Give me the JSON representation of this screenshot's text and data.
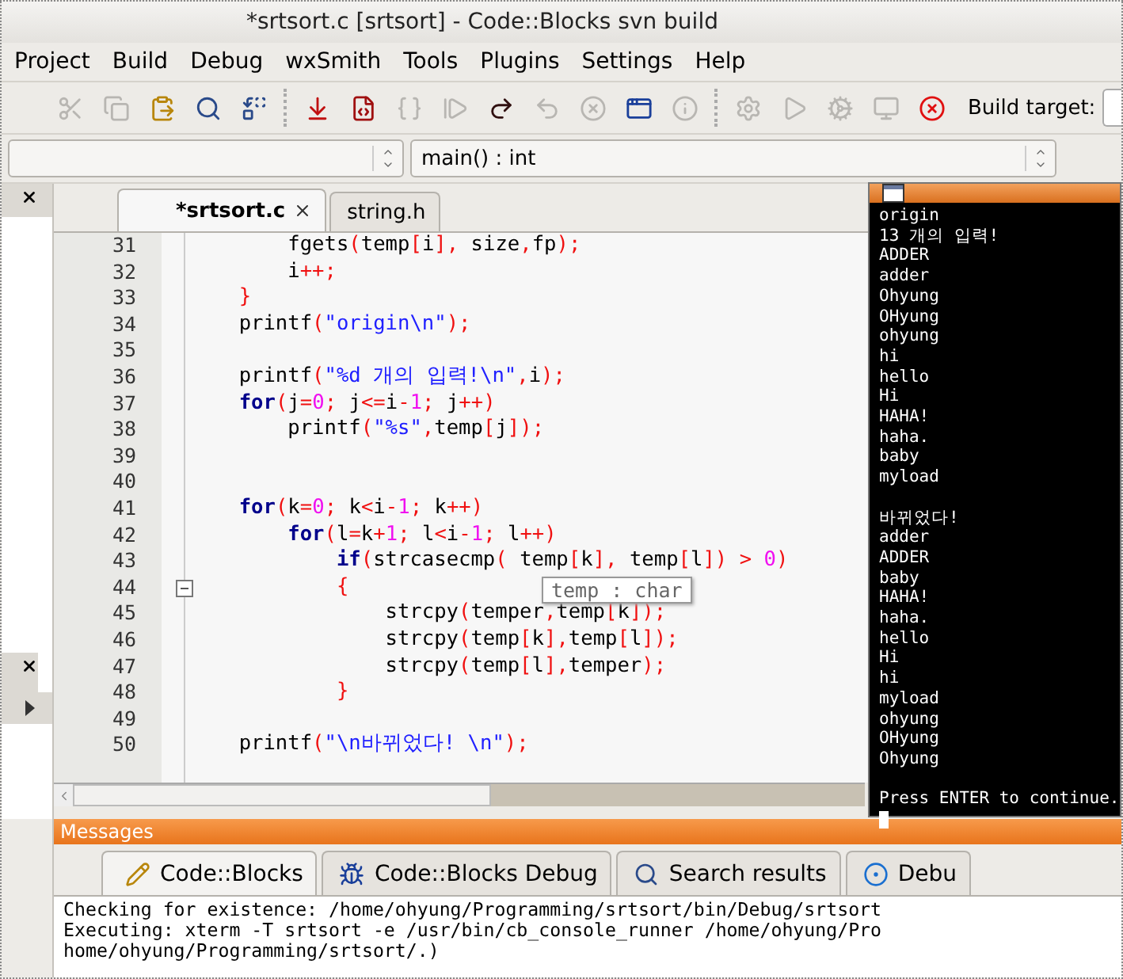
{
  "window": {
    "title": "*srtsort.c [srtsort] - Code::Blocks svn build"
  },
  "menu": [
    "Project",
    "Build",
    "Debug",
    "wxSmith",
    "Tools",
    "Plugins",
    "Settings",
    "Help"
  ],
  "toolbar": [
    [
      {
        "disabled": true
      },
      {
        "disabled": true
      },
      {
        "disabled": false
      },
      {
        "disabled": false
      },
      {
        "disabled": false
      }
    ],
    [
      {
        "disabled": false
      },
      {
        "disabled": false
      },
      {
        "disabled": true
      },
      {
        "disabled": true
      },
      {
        "disabled": false
      },
      {
        "disabled": true
      },
      {
        "disabled": true
      },
      {
        "disabled": false
      },
      {
        "disabled": true
      }
    ],
    [
      {
        "disabled": true
      },
      {
        "disabled": true
      },
      {
        "disabled": true
      },
      {
        "disabled": true
      },
      {
        "disabled": false
      }
    ]
  ],
  "build_target": {
    "label": "Build target:"
  },
  "symbol_bar": {
    "function": "main() : int"
  },
  "editor": {
    "tabs": [
      {
        "label": "*srtsort.c",
        "selected": true
      },
      {
        "label": "string.h",
        "selected": false
      }
    ],
    "lines": [
      {
        "number": "31",
        "tokens": [
          {
            "kind": "plain",
            "text": "        fgets"
          },
          {
            "kind": "punct",
            "text": "("
          },
          {
            "kind": "plain",
            "text": "temp"
          },
          {
            "kind": "punct",
            "text": "["
          },
          {
            "kind": "plain",
            "text": "i"
          },
          {
            "kind": "punct",
            "text": "],"
          },
          {
            "kind": "plain",
            "text": " size"
          },
          {
            "kind": "punct",
            "text": ","
          },
          {
            "kind": "plain",
            "text": "fp"
          },
          {
            "kind": "punct",
            "text": ");"
          }
        ]
      },
      {
        "number": "32",
        "tokens": [
          {
            "kind": "plain",
            "text": "        i"
          },
          {
            "kind": "punct",
            "text": "++;"
          }
        ]
      },
      {
        "number": "33",
        "tokens": [
          {
            "kind": "punct",
            "text": "    }"
          }
        ]
      },
      {
        "number": "34",
        "tokens": [
          {
            "kind": "plain",
            "text": "    printf"
          },
          {
            "kind": "punct",
            "text": "("
          },
          {
            "kind": "string",
            "text": "\"origin\\n\""
          },
          {
            "kind": "punct",
            "text": ");"
          }
        ]
      },
      {
        "number": "35"
      },
      {
        "number": "36",
        "tokens": [
          {
            "kind": "plain",
            "text": "    printf"
          },
          {
            "kind": "punct",
            "text": "("
          },
          {
            "kind": "string",
            "text": "\"%d 개의 입력!\\n\""
          },
          {
            "kind": "punct",
            "text": ","
          },
          {
            "kind": "plain",
            "text": "i"
          },
          {
            "kind": "punct",
            "text": ");"
          }
        ]
      },
      {
        "number": "37",
        "tokens": [
          {
            "kind": "keyword",
            "text": "    for"
          },
          {
            "kind": "punct",
            "text": "("
          },
          {
            "kind": "plain",
            "text": "j"
          },
          {
            "kind": "punct",
            "text": "="
          },
          {
            "kind": "number",
            "text": "0"
          },
          {
            "kind": "punct",
            "text": ";"
          },
          {
            "kind": "plain",
            "text": " j"
          },
          {
            "kind": "punct",
            "text": "<="
          },
          {
            "kind": "plain",
            "text": "i"
          },
          {
            "kind": "punct",
            "text": "-"
          },
          {
            "kind": "number",
            "text": "1"
          },
          {
            "kind": "punct",
            "text": ";"
          },
          {
            "kind": "plain",
            "text": " j"
          },
          {
            "kind": "punct",
            "text": "++)"
          }
        ]
      },
      {
        "number": "38",
        "tokens": [
          {
            "kind": "plain",
            "text": "        printf"
          },
          {
            "kind": "punct",
            "text": "("
          },
          {
            "kind": "string",
            "text": "\"%s\""
          },
          {
            "kind": "punct",
            "text": ","
          },
          {
            "kind": "plain",
            "text": "temp"
          },
          {
            "kind": "punct",
            "text": "["
          },
          {
            "kind": "plain",
            "text": "j"
          },
          {
            "kind": "punct",
            "text": "]);"
          }
        ]
      },
      {
        "number": "39"
      },
      {
        "number": "40"
      },
      {
        "number": "41",
        "tokens": [
          {
            "kind": "keyword",
            "text": "    for"
          },
          {
            "kind": "punct",
            "text": "("
          },
          {
            "kind": "plain",
            "text": "k"
          },
          {
            "kind": "punct",
            "text": "="
          },
          {
            "kind": "number",
            "text": "0"
          },
          {
            "kind": "punct",
            "text": ";"
          },
          {
            "kind": "plain",
            "text": " k"
          },
          {
            "kind": "punct",
            "text": "<"
          },
          {
            "kind": "plain",
            "text": "i"
          },
          {
            "kind": "punct",
            "text": "-"
          },
          {
            "kind": "number",
            "text": "1"
          },
          {
            "kind": "punct",
            "text": ";"
          },
          {
            "kind": "plain",
            "text": " k"
          },
          {
            "kind": "punct",
            "text": "++)"
          }
        ]
      },
      {
        "number": "42",
        "tokens": [
          {
            "kind": "keyword",
            "text": "        for"
          },
          {
            "kind": "punct",
            "text": "("
          },
          {
            "kind": "plain",
            "text": "l"
          },
          {
            "kind": "punct",
            "text": "="
          },
          {
            "kind": "plain",
            "text": "k"
          },
          {
            "kind": "punct",
            "text": "+"
          },
          {
            "kind": "number",
            "text": "1"
          },
          {
            "kind": "punct",
            "text": ";"
          },
          {
            "kind": "plain",
            "text": " l"
          },
          {
            "kind": "punct",
            "text": "<"
          },
          {
            "kind": "plain",
            "text": "i"
          },
          {
            "kind": "punct",
            "text": "-"
          },
          {
            "kind": "number",
            "text": "1"
          },
          {
            "kind": "punct",
            "text": ";"
          },
          {
            "kind": "plain",
            "text": " l"
          },
          {
            "kind": "punct",
            "text": "++)"
          }
        ]
      },
      {
        "number": "43",
        "tokens": [
          {
            "kind": "keyword",
            "text": "            if"
          },
          {
            "kind": "punct",
            "text": "("
          },
          {
            "kind": "plain",
            "text": "strcasecmp"
          },
          {
            "kind": "punct",
            "text": "("
          },
          {
            "kind": "plain",
            "text": " temp"
          },
          {
            "kind": "punct",
            "text": "["
          },
          {
            "kind": "plain",
            "text": "k"
          },
          {
            "kind": "punct",
            "text": "],"
          },
          {
            "kind": "plain",
            "text": " temp"
          },
          {
            "kind": "punct",
            "text": "["
          },
          {
            "kind": "plain",
            "text": "l"
          },
          {
            "kind": "punct",
            "text": "]) > "
          },
          {
            "kind": "number",
            "text": "0"
          },
          {
            "kind": "punct",
            "text": ")"
          }
        ]
      },
      {
        "number": "44",
        "fold": true,
        "tokens": [
          {
            "kind": "punct",
            "text": "            {"
          }
        ]
      },
      {
        "number": "45",
        "tokens": [
          {
            "kind": "plain",
            "text": "                strcpy"
          },
          {
            "kind": "punct",
            "text": "("
          },
          {
            "kind": "plain",
            "text": "temper"
          },
          {
            "kind": "punct",
            "text": ","
          },
          {
            "kind": "plain",
            "text": "temp"
          },
          {
            "kind": "punct",
            "text": "["
          },
          {
            "kind": "plain",
            "text": "k"
          },
          {
            "kind": "punct",
            "text": "]);"
          }
        ]
      },
      {
        "number": "46",
        "tokens": [
          {
            "kind": "plain",
            "text": "                strcpy"
          },
          {
            "kind": "punct",
            "text": "("
          },
          {
            "kind": "plain",
            "text": "temp"
          },
          {
            "kind": "punct",
            "text": "["
          },
          {
            "kind": "plain",
            "text": "k"
          },
          {
            "kind": "punct",
            "text": "],"
          },
          {
            "kind": "plain",
            "text": "temp"
          },
          {
            "kind": "punct",
            "text": "["
          },
          {
            "kind": "plain",
            "text": "l"
          },
          {
            "kind": "punct",
            "text": "]);"
          }
        ]
      },
      {
        "number": "47",
        "tokens": [
          {
            "kind": "plain",
            "text": "                strcpy"
          },
          {
            "kind": "punct",
            "text": "("
          },
          {
            "kind": "plain",
            "text": "temp"
          },
          {
            "kind": "punct",
            "text": "["
          },
          {
            "kind": "plain",
            "text": "l"
          },
          {
            "kind": "punct",
            "text": "],"
          },
          {
            "kind": "plain",
            "text": "temper"
          },
          {
            "kind": "punct",
            "text": ");"
          }
        ]
      },
      {
        "number": "48",
        "tokens": [
          {
            "kind": "punct",
            "text": "            }"
          }
        ]
      },
      {
        "number": "49"
      },
      {
        "number": "50",
        "tokens": [
          {
            "kind": "plain",
            "text": "    printf"
          },
          {
            "kind": "punct",
            "text": "("
          },
          {
            "kind": "string",
            "text": "\"\\n바뀌었다! \\n\""
          },
          {
            "kind": "punct",
            "text": ");"
          }
        ]
      }
    ],
    "tooltip": "temp : char"
  },
  "messages": {
    "title": "Messages",
    "tabs": [
      {
        "label": "Code::Blocks",
        "selected": true
      },
      {
        "label": "Code::Blocks Debug",
        "selected": false
      },
      {
        "label": "Search results",
        "selected": false
      },
      {
        "label": "Debu",
        "selected": false
      }
    ],
    "log": [
      "Checking for existence: /home/ohyung/Programming/srtsort/bin/Debug/srtsort",
      "Executing: xterm -T srtsort -e /usr/bin/cb_console_runner /home/ohyung/Pro",
      "home/ohyung/Programming/srtsort/.)"
    ]
  },
  "terminal": {
    "blocks": [
      [
        "origin",
        "13 개의 입력!",
        "ADDER",
        "adder",
        "Ohyung",
        "OHyung",
        "ohyung",
        "hi",
        "hello",
        "Hi",
        "HAHA!",
        "haha.",
        "baby",
        "myload"
      ],
      [
        "바뀌었다!",
        "adder",
        "ADDER",
        "baby",
        "HAHA!",
        "haha.",
        "hello",
        "Hi",
        "hi",
        "myload",
        "ohyung",
        "OHyung",
        "Ohyung"
      ],
      [
        "Press ENTER to continue."
      ]
    ]
  }
}
